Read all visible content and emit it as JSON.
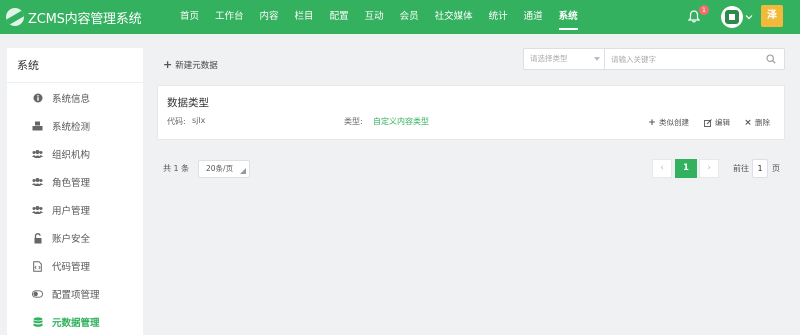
{
  "app": {
    "logo_text": "ZCMS内容管理系统"
  },
  "nav": {
    "items": [
      {
        "label": "首页"
      },
      {
        "label": "工作台"
      },
      {
        "label": "内容"
      },
      {
        "label": "栏目"
      },
      {
        "label": "配置"
      },
      {
        "label": "互动"
      },
      {
        "label": "会员"
      },
      {
        "label": "社交媒体"
      },
      {
        "label": "统计"
      },
      {
        "label": "通道"
      },
      {
        "label": "系统",
        "active": true
      }
    ]
  },
  "header": {
    "notification_count": "1",
    "avatar_text": "泽"
  },
  "sidebar": {
    "title": "系统",
    "items": [
      {
        "label": "系统信息",
        "icon": "info-icon"
      },
      {
        "label": "系统检测",
        "icon": "cubes-icon"
      },
      {
        "label": "组织机构",
        "icon": "users-icon"
      },
      {
        "label": "角色管理",
        "icon": "users-icon"
      },
      {
        "label": "用户管理",
        "icon": "users-icon"
      },
      {
        "label": "账户安全",
        "icon": "unlock-icon"
      },
      {
        "label": "代码管理",
        "icon": "code-file-icon"
      },
      {
        "label": "配置项管理",
        "icon": "toggle-icon"
      },
      {
        "label": "元数据管理",
        "icon": "database-icon",
        "active": true
      }
    ]
  },
  "toolbar": {
    "add_label": "新建元数据",
    "type_select_placeholder": "请选择类型",
    "search_placeholder": "请输入关键字"
  },
  "card": {
    "title": "数据类型",
    "code_label": "代码:",
    "code_value": "sjlx",
    "type_label": "类型:",
    "type_value": "自定义内容类型",
    "actions": {
      "copy": "类似创建",
      "edit": "编辑",
      "delete": "删除"
    }
  },
  "pagination": {
    "total_text": "共 1 条",
    "page_size": "20条/页",
    "current_page": "1",
    "goto_label": "前往",
    "goto_value": "1",
    "goto_unit": "页"
  },
  "colors": {
    "brand": "#33b15e",
    "avatar": "#f2b93b",
    "badge": "#f56c6c"
  }
}
